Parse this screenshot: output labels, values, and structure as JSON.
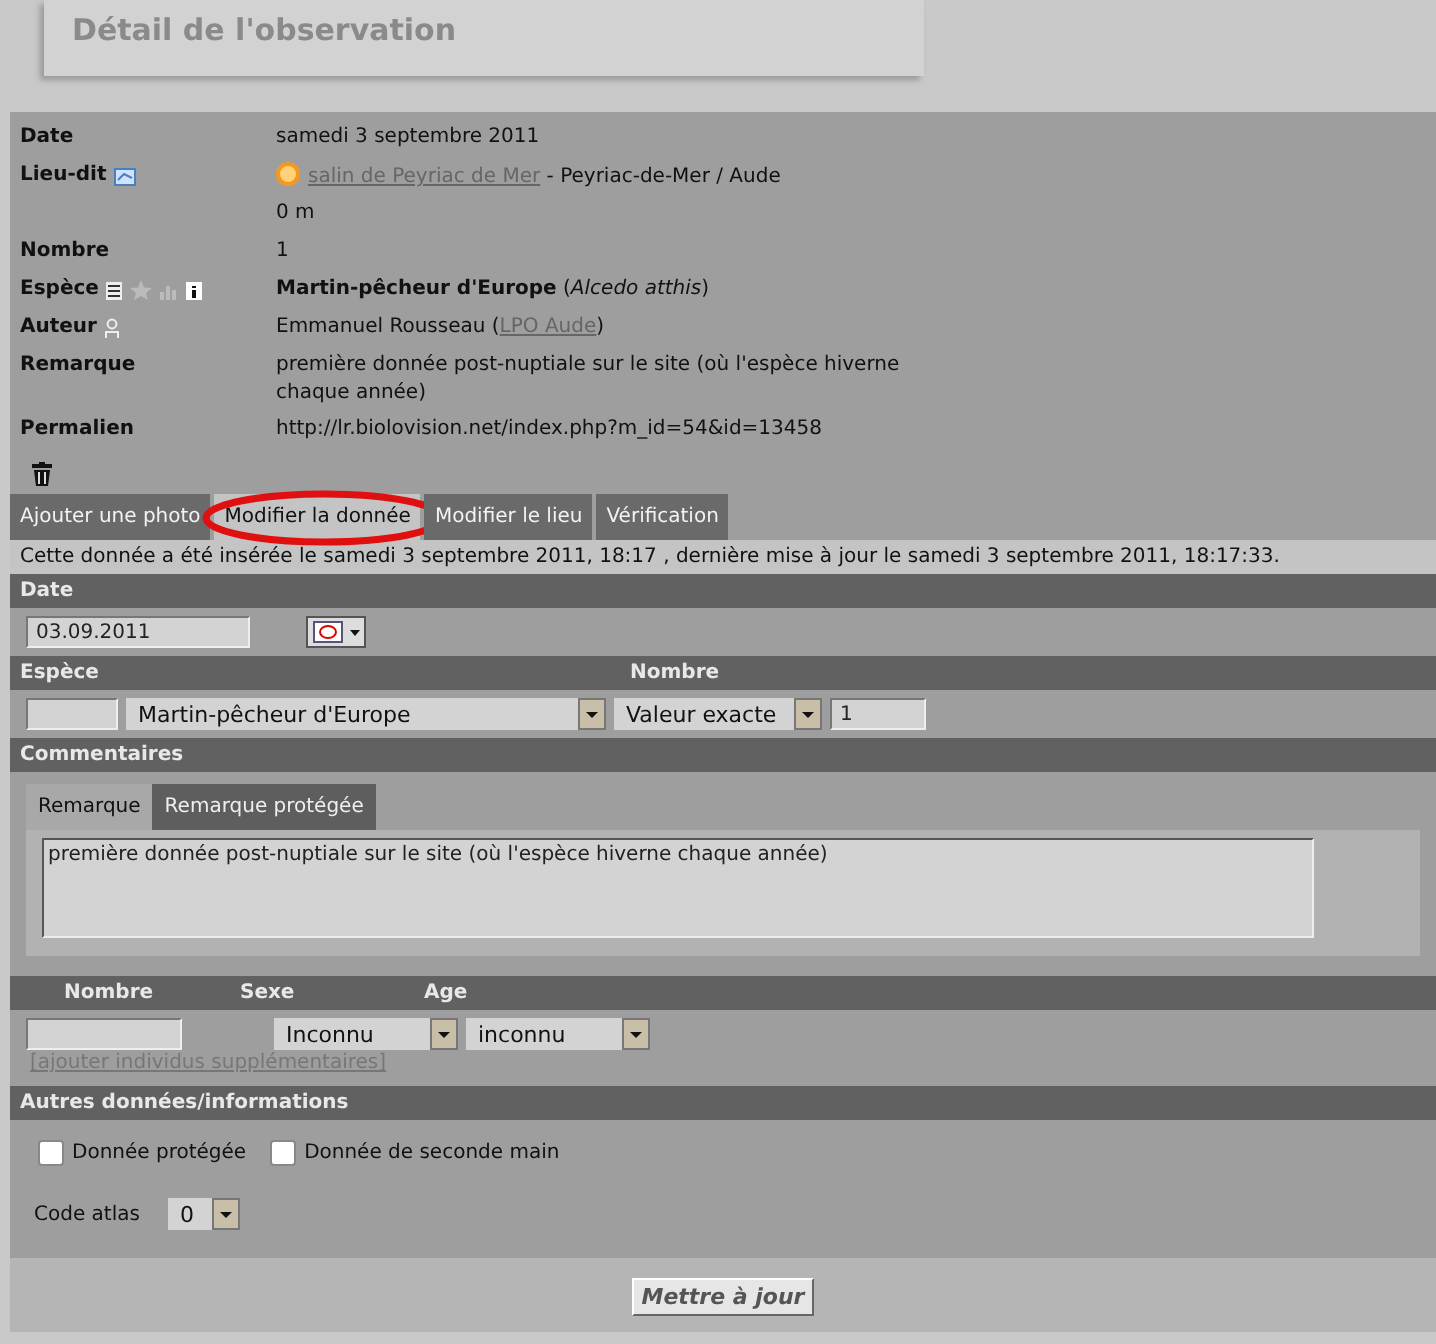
{
  "page_title": "Détail de l'observation",
  "details": [
    {
      "label": "Date",
      "value": "samedi 3 septembre 2011"
    },
    {
      "label": "Lieu-dit",
      "kind": "place",
      "link": "salin de Peyriac de Mer",
      "value": " - Peyriac-de-Mer / Aude"
    },
    {
      "value": "0 m"
    },
    {
      "label": "Nombre",
      "value": "1"
    },
    {
      "label": "Espèce",
      "kind": "species",
      "value": "**Martin-pêcheur d'Europe** (*Alcedo atthis*)"
    },
    {
      "label": "Auteur",
      "kind": "author",
      "value": "Emmanuel Rousseau (",
      "link_after": "LPO Aude",
      "value_end": ")"
    },
    {
      "label": "Remarque",
      "value": "première donnée post-nuptiale sur le site (où l'espèce hiverne chaque année)"
    },
    {
      "label": "Permalien",
      "value": "http://lr.biolovision.net/index.php?m_id=54&id=13458"
    }
  ],
  "tabs": [
    {
      "label": "Ajouter une photo",
      "selected": false,
      "circled": false
    },
    {
      "label": "Modifier la donnée",
      "selected": true,
      "circled": true
    },
    {
      "label": "Modifier le lieu",
      "selected": false,
      "circled": false
    },
    {
      "label": "Vérification",
      "selected": false,
      "circled": false
    }
  ],
  "info": "Cette donnée a été insérée le samedi 3 septembre 2011, 18:17 , dernière mise à jour le samedi 3 septembre 2011, 18:17:33.",
  "date_section": {
    "header": "Date",
    "value": "03.09.2011"
  },
  "species_section": {
    "header_species": "Espèce",
    "header_count": "Nombre",
    "species": "Martin-pêcheur d'Europe",
    "count_type": "Valeur exacte",
    "count": "1"
  },
  "comments": {
    "header": "Commentaires",
    "tabs": [
      {
        "label": "Remarque",
        "selected": true
      },
      {
        "label": "Remarque protégée",
        "selected": false
      }
    ],
    "text": "première donnée post-nuptiale sur le site (où l'espèce hiverne chaque année)"
  },
  "individuals": {
    "headers": [
      "Nombre",
      "Sexe",
      "Age"
    ],
    "sex": "Inconnu",
    "age": "inconnu",
    "add_link": "[ajouter individus supplémentaires]"
  },
  "other": {
    "header": "Autres données/informations",
    "checkboxes": [
      {
        "label": "Donnée protégée",
        "checked": false
      },
      {
        "label": "Donnée de seconde main",
        "checked": false
      }
    ],
    "atlas_label": "Code atlas",
    "atlas_value": "0"
  },
  "submit": "Mettre à jour"
}
